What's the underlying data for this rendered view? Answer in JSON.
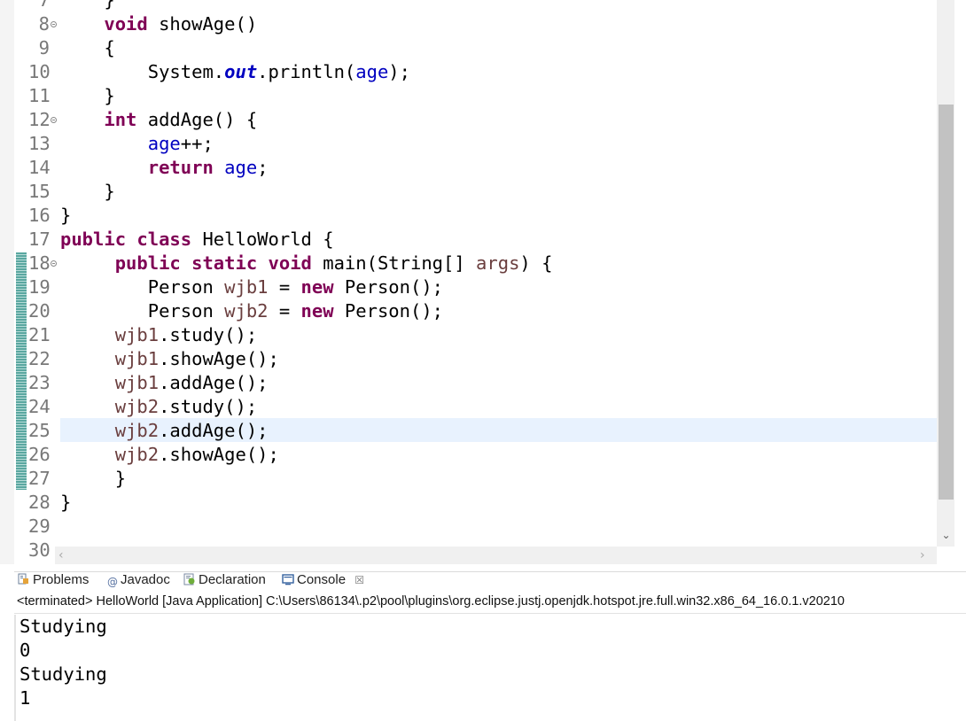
{
  "editor": {
    "lines": [
      {
        "num": "7",
        "parts": [
          {
            "t": "    }"
          }
        ]
      },
      {
        "num": "8",
        "fold": true,
        "parts": [
          {
            "t": "    "
          },
          {
            "t": "void",
            "c": "kw"
          },
          {
            "t": " showAge()"
          }
        ]
      },
      {
        "num": "9",
        "parts": [
          {
            "t": "    {"
          }
        ]
      },
      {
        "num": "10",
        "parts": [
          {
            "t": "        System."
          },
          {
            "t": "out",
            "c": "fld-it"
          },
          {
            "t": ".println("
          },
          {
            "t": "age",
            "c": "fld"
          },
          {
            "t": ");"
          }
        ]
      },
      {
        "num": "11",
        "parts": [
          {
            "t": "    }"
          }
        ]
      },
      {
        "num": "12",
        "fold": true,
        "parts": [
          {
            "t": "    "
          },
          {
            "t": "int",
            "c": "kw"
          },
          {
            "t": " addAge() {"
          }
        ]
      },
      {
        "num": "13",
        "parts": [
          {
            "t": "        "
          },
          {
            "t": "age",
            "c": "fld"
          },
          {
            "t": "++;"
          }
        ]
      },
      {
        "num": "14",
        "parts": [
          {
            "t": "        "
          },
          {
            "t": "return",
            "c": "kw"
          },
          {
            "t": " "
          },
          {
            "t": "age",
            "c": "fld"
          },
          {
            "t": ";"
          }
        ]
      },
      {
        "num": "15",
        "parts": [
          {
            "t": "    }"
          }
        ]
      },
      {
        "num": "16",
        "parts": [
          {
            "t": "}"
          }
        ]
      },
      {
        "num": "17",
        "parts": [
          {
            "t": "public",
            "c": "kw"
          },
          {
            "t": " "
          },
          {
            "t": "class",
            "c": "kw"
          },
          {
            "t": " HelloWorld {"
          }
        ]
      },
      {
        "num": "18",
        "fold": true,
        "parts": [
          {
            "t": "     "
          },
          {
            "t": "public",
            "c": "kw"
          },
          {
            "t": " "
          },
          {
            "t": "static",
            "c": "kw"
          },
          {
            "t": " "
          },
          {
            "t": "void",
            "c": "kw"
          },
          {
            "t": " main(String[] "
          },
          {
            "t": "args",
            "c": "var"
          },
          {
            "t": ") {"
          }
        ]
      },
      {
        "num": "19",
        "parts": [
          {
            "t": "        Person "
          },
          {
            "t": "wjb1",
            "c": "var"
          },
          {
            "t": " = "
          },
          {
            "t": "new",
            "c": "kw"
          },
          {
            "t": " Person();"
          }
        ]
      },
      {
        "num": "20",
        "parts": [
          {
            "t": "        Person "
          },
          {
            "t": "wjb2",
            "c": "var"
          },
          {
            "t": " = "
          },
          {
            "t": "new",
            "c": "kw"
          },
          {
            "t": " Person();"
          }
        ]
      },
      {
        "num": "21",
        "parts": [
          {
            "t": "     "
          },
          {
            "t": "wjb1",
            "c": "var"
          },
          {
            "t": ".study();"
          }
        ]
      },
      {
        "num": "22",
        "parts": [
          {
            "t": "     "
          },
          {
            "t": "wjb1",
            "c": "var"
          },
          {
            "t": ".showAge();"
          }
        ]
      },
      {
        "num": "23",
        "parts": [
          {
            "t": "     "
          },
          {
            "t": "wjb1",
            "c": "var"
          },
          {
            "t": ".addAge();"
          }
        ]
      },
      {
        "num": "24",
        "parts": [
          {
            "t": "     "
          },
          {
            "t": "wjb2",
            "c": "var"
          },
          {
            "t": ".study();"
          }
        ]
      },
      {
        "num": "25",
        "parts": [
          {
            "t": "     "
          },
          {
            "t": "wjb2",
            "c": "var"
          },
          {
            "t": ".addAge();"
          }
        ]
      },
      {
        "num": "26",
        "parts": [
          {
            "t": "     "
          },
          {
            "t": "wjb2",
            "c": "var"
          },
          {
            "t": ".showAge();"
          }
        ]
      },
      {
        "num": "27",
        "parts": [
          {
            "t": "     }"
          }
        ]
      },
      {
        "num": "28",
        "parts": [
          {
            "t": "}"
          }
        ]
      },
      {
        "num": "29",
        "parts": [
          {
            "t": ""
          }
        ]
      },
      {
        "num": "30",
        "parts": [
          {
            "t": ""
          }
        ]
      }
    ]
  },
  "console": {
    "tabs": [
      {
        "label": "Problems",
        "icon": "problems-icon"
      },
      {
        "label": "Javadoc",
        "icon": "javadoc-icon"
      },
      {
        "label": "Declaration",
        "icon": "declaration-icon"
      },
      {
        "label": "Console",
        "icon": "console-icon",
        "active": true
      }
    ],
    "close_glyph": "☒",
    "status": "<terminated> HelloWorld [Java Application] C:\\Users\\86134\\.p2\\pool\\plugins\\org.eclipse.justj.openjdk.hotspot.jre.full.win32.x86_64_16.0.1.v20210",
    "output": [
      "Studying",
      "0",
      "Studying",
      "1"
    ]
  },
  "colors": {
    "keyword": "#7f0055",
    "field": "#0000c0",
    "local_var": "#6a3e3e",
    "current_line": "#e8f2fe"
  }
}
